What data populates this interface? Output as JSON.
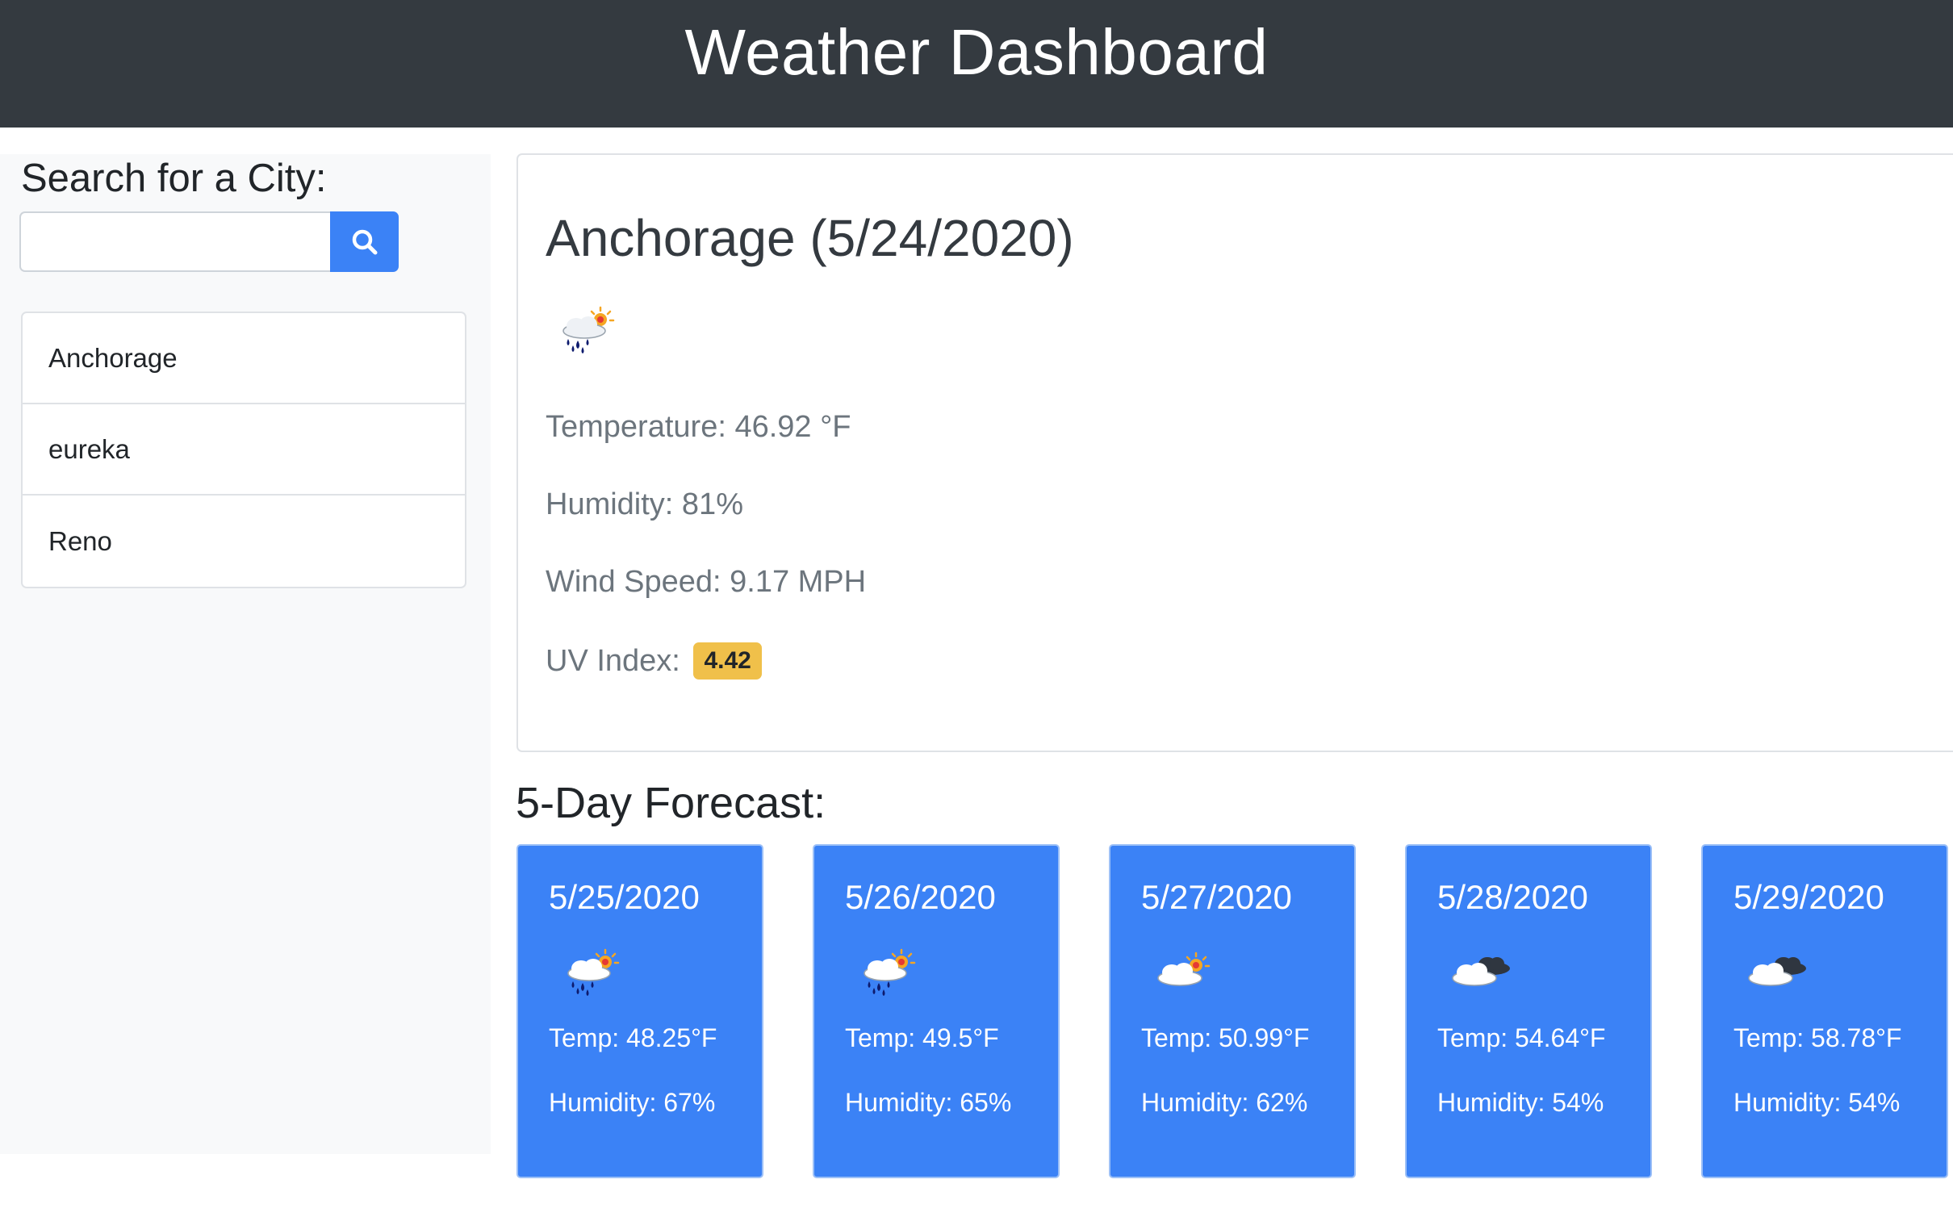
{
  "header": {
    "title": "Weather Dashboard"
  },
  "search": {
    "title": "Search for a City:",
    "input_value": "",
    "button_icon": "search-icon"
  },
  "cities": [
    {
      "label": "Anchorage"
    },
    {
      "label": "eureka"
    },
    {
      "label": "Reno"
    }
  ],
  "current": {
    "title": "Anchorage (5/24/2020)",
    "icon": "rain-sun-icon",
    "temperature": "Temperature: 46.92 °F",
    "humidity": "Humidity: 81%",
    "wind": "Wind Speed: 9.17 MPH",
    "uv_label": "UV Index:",
    "uv_value": "4.42"
  },
  "forecast": {
    "title": "5-Day Forecast:",
    "days": [
      {
        "date": "5/25/2020",
        "icon": "rain-sun-icon",
        "temp": "Temp: 48.25°F",
        "humidity": "Humidity: 67%"
      },
      {
        "date": "5/26/2020",
        "icon": "rain-sun-icon",
        "temp": "Temp: 49.5°F",
        "humidity": "Humidity: 65%"
      },
      {
        "date": "5/27/2020",
        "icon": "cloud-sun-icon",
        "temp": "Temp: 50.99°F",
        "humidity": "Humidity: 62%"
      },
      {
        "date": "5/28/2020",
        "icon": "cloudy-icon",
        "temp": "Temp: 54.64°F",
        "humidity": "Humidity: 54%"
      },
      {
        "date": "5/29/2020",
        "icon": "cloudy-icon",
        "temp": "Temp: 58.78°F",
        "humidity": "Humidity: 54%"
      }
    ]
  },
  "colors": {
    "navbar": "#343a40",
    "primary": "#3b82f6",
    "uv_badge": "#f0c04a"
  }
}
